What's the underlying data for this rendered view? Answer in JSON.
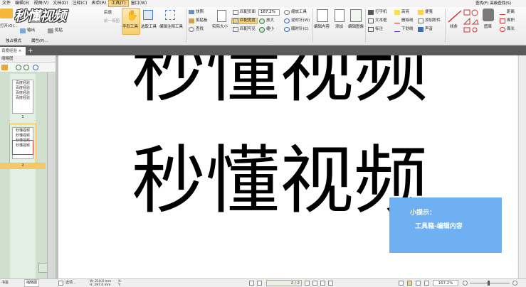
{
  "menu": [
    "文件",
    "编辑(E)",
    "视图(V)",
    "文档(D)",
    "注释(C)",
    "表单(R)",
    "工具(T)",
    "窗口(W)"
  ],
  "menu_active_index": 6,
  "menu_right": [
    "查找(F)",
    "高级查找(S)"
  ],
  "logo": {
    "text": "秒懂视频"
  },
  "ribbon": {
    "open": "打开(O)...",
    "back": "后退",
    "forward": "前一视图",
    "export": "输出",
    "clip": "剪贴",
    "hand_tool": "手形工具",
    "select_tool": "选取工具",
    "annot_tool": "编辑注释工具",
    "snapshot": "快照",
    "clipboard": "剪贴板",
    "find": "查找",
    "actual_size": "实际大小",
    "fit_page": "匹配页面",
    "fit_width": "匹配宽度",
    "fit_visible": "匹配可见",
    "zoom_value": "167.2%",
    "zoom_in": "放大",
    "zoom_out": "缩小",
    "zoom_tool": "缩放工具",
    "rotate_left": "逆时针(W)",
    "rotate_right": "顺时针(C)",
    "edit_content": "编辑内容",
    "add": "添加",
    "edit_image": "编辑图像",
    "typewriter": "打字机",
    "textbox": "文本框",
    "callout": "标注",
    "highlight": "高亮",
    "strikeout": "删除线",
    "underline": "下划线",
    "note": "便笺",
    "add_attachment": "添加附件",
    "sound": "声音",
    "line": "线条",
    "stamp": "图章",
    "distance": "距离",
    "area": "面积",
    "perimeter": "周长"
  },
  "quick": {
    "float": "独占模式",
    "props": "属性(P)..."
  },
  "tabs": [
    {
      "label": "百度经验"
    }
  ],
  "panel": {
    "title": "缩略图",
    "thumbs": [
      {
        "lines": [
          "百度经验",
          "百度经验",
          "百度经验",
          "百度经验"
        ],
        "label": "1"
      },
      {
        "lines": [
          "秒懂视频",
          "秒懂视频",
          "秒懂视频",
          "秒懂视频"
        ],
        "label": "2"
      }
    ]
  },
  "page_text": {
    "line1": "秒懂视频",
    "line2": "秒懂视频"
  },
  "hint": {
    "title": "小提示：",
    "body": "工具箱-编辑内容"
  },
  "status": {
    "page_tab": "书签",
    "thumb_tab": "缩略图",
    "mode": "选项...",
    "width": "W: 210.0 mm",
    "height": "H: 297.0 mm",
    "xlabel": "X:",
    "ylabel": "Y:",
    "page_indicator": "2 / 2",
    "zoom": "167.2%"
  },
  "colors": {
    "hint_bg": "#6fb0f2",
    "menu_active": "#f0d596"
  }
}
